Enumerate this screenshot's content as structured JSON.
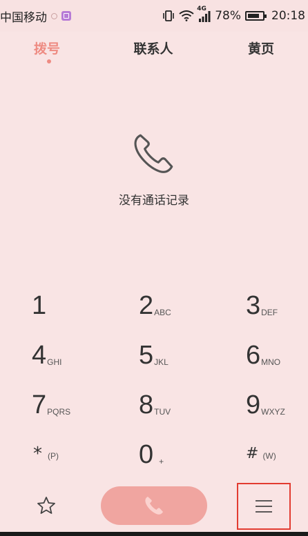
{
  "status_bar": {
    "carrier": "中国移动",
    "network": "4G",
    "battery": "78%",
    "battery_level": 0.78,
    "time": "20:18"
  },
  "tabs": [
    {
      "label": "拨号",
      "active": true
    },
    {
      "label": "联系人",
      "active": false
    },
    {
      "label": "黄页",
      "active": false
    }
  ],
  "empty_state": {
    "icon": "phone-handset-icon",
    "text": "没有通话记录"
  },
  "dialpad": [
    {
      "digit": "1",
      "letters": ""
    },
    {
      "digit": "2",
      "letters": "ABC"
    },
    {
      "digit": "3",
      "letters": "DEF"
    },
    {
      "digit": "4",
      "letters": "GHI"
    },
    {
      "digit": "5",
      "letters": "JKL"
    },
    {
      "digit": "6",
      "letters": "MNO"
    },
    {
      "digit": "7",
      "letters": "PQRS"
    },
    {
      "digit": "8",
      "letters": "TUV"
    },
    {
      "digit": "9",
      "letters": "WXYZ"
    },
    {
      "digit": "*",
      "letters": "(P)"
    },
    {
      "digit": "0",
      "letters": "+"
    },
    {
      "digit": "#",
      "letters": "(W)"
    }
  ],
  "bottom_bar": {
    "favorites_icon": "star-icon",
    "call_icon": "phone-icon",
    "menu_icon": "menu-icon"
  },
  "colors": {
    "background": "#f9e4e4",
    "accent": "#ee8b82",
    "call_button": "#f0a5a0",
    "highlight_box": "#e23b30"
  }
}
